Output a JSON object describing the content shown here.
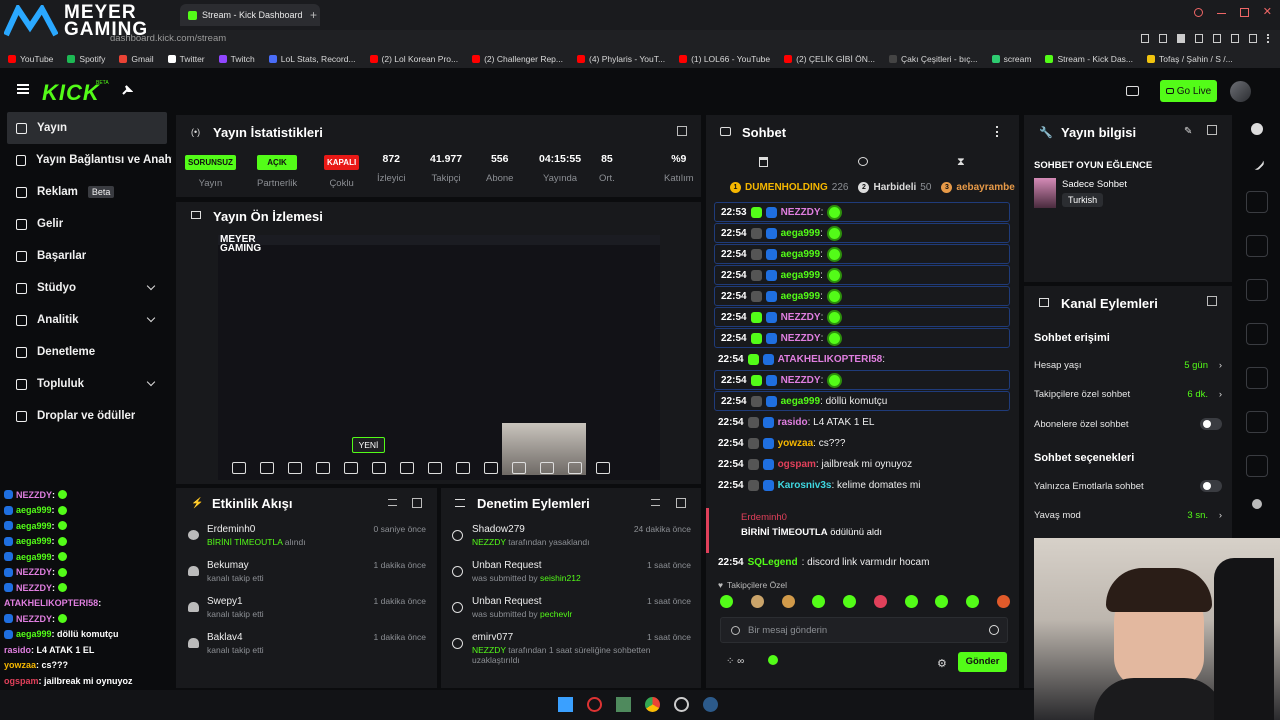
{
  "browser": {
    "tab_title": "Stream - Kick Dashboard",
    "address": "dashboard.kick.com/stream",
    "bookmarks": [
      {
        "label": "YouTube",
        "color": "#ff0000"
      },
      {
        "label": "Spotify",
        "color": "#1db954"
      },
      {
        "label": "Gmail",
        "color": "#ea4335"
      },
      {
        "label": "Twitter",
        "color": "#ffffff"
      },
      {
        "label": "Twitch",
        "color": "#9146ff"
      },
      {
        "label": "LoL Stats, Record...",
        "color": "#4a6cf7"
      },
      {
        "label": "(2) Lol Korean Pro...",
        "color": "#ff0000"
      },
      {
        "label": "(2) Challenger Rep...",
        "color": "#ff0000"
      },
      {
        "label": "(4) Phylaris - YouT...",
        "color": "#ff0000"
      },
      {
        "label": "(1) LOL66 - YouTube",
        "color": "#ff0000"
      },
      {
        "label": "(2) ÇELİK GİBİ ÖN...",
        "color": "#ff0000"
      },
      {
        "label": "Çakı Çeşitleri - bıç...",
        "color": "#444444"
      },
      {
        "label": "scream",
        "color": "#2ecc71"
      },
      {
        "label": "Stream - Kick Das...",
        "color": "#53fc18"
      },
      {
        "label": "Tofaş / Şahin / S /...",
        "color": "#f1c40f"
      }
    ]
  },
  "overlay_logo": {
    "line1": "MEYER",
    "line2": "GAMING"
  },
  "header": {
    "logo": "KICK",
    "logo_sup": "BETA",
    "go_live": "Go Live"
  },
  "sidebar": {
    "items": [
      {
        "label": "Yayın",
        "icon": "broadcast-icon"
      },
      {
        "label": "Yayın Bağlantısı ve Anahtarı",
        "icon": "link-icon"
      },
      {
        "label": "Reklam",
        "icon": "ad-icon",
        "badge": "Beta"
      },
      {
        "label": "Gelir",
        "icon": "revenue-icon"
      },
      {
        "label": "Başarılar",
        "icon": "trophy-icon"
      },
      {
        "label": "Stüdyo",
        "icon": "studio-icon"
      },
      {
        "label": "Analitik",
        "icon": "analytics-icon"
      },
      {
        "label": "Denetleme",
        "icon": "moderation-icon"
      },
      {
        "label": "Topluluk",
        "icon": "community-icon"
      },
      {
        "label": "Droplar ve ödüller",
        "icon": "drops-icon"
      }
    ]
  },
  "stats": {
    "title": "Yayın İstatistikleri",
    "items": [
      {
        "value": "SORUNSUZ",
        "label": "Yayın",
        "type": "green"
      },
      {
        "value": "AÇIK",
        "label": "Partnerlik",
        "type": "green"
      },
      {
        "value": "KAPALI",
        "label": "Çoklu",
        "type": "red"
      },
      {
        "value": "872",
        "label": "İzleyici",
        "type": "num"
      },
      {
        "value": "41.977",
        "label": "Takipçi",
        "type": "num"
      },
      {
        "value": "556",
        "label": "Abone",
        "type": "num"
      },
      {
        "value": "04:15:55",
        "label": "Yayında",
        "type": "num"
      },
      {
        "value": "85",
        "label": "Ort.",
        "type": "num"
      },
      {
        "value": "%9",
        "label": "Katılım",
        "type": "num"
      }
    ]
  },
  "preview": {
    "title": "Yayın Ön İzlemesi",
    "new_label": "YENİ"
  },
  "activity": {
    "title": "Etkinlik Akışı",
    "items": [
      {
        "name": "Erdeminh0",
        "detail_a": "BİRİNİ TİMEOUTLA",
        "detail_b": " alındı",
        "time": "0 saniye önce",
        "icon": "redeem-icon"
      },
      {
        "name": "Bekumay",
        "detail_a": "",
        "detail_b": "kanalı takip etti",
        "time": "1 dakika önce",
        "icon": "heart-icon"
      },
      {
        "name": "Swepy1",
        "detail_a": "",
        "detail_b": "kanalı takip etti",
        "time": "1 dakika önce",
        "icon": "heart-icon"
      },
      {
        "name": "Baklav4",
        "detail_a": "",
        "detail_b": "kanalı takip etti",
        "time": "1 dakika önce",
        "icon": "heart-icon"
      }
    ]
  },
  "moderation": {
    "title": "Denetim Eylemleri",
    "items": [
      {
        "title": "Shadow279",
        "by": "NEZZDY",
        "text": " tarafından yasaklandı",
        "time": "24 dakika önce",
        "icon": "ban-icon"
      },
      {
        "title": "Unban Request",
        "by": "seishin212",
        "text": "was submitted by ",
        "time": "1 saat önce",
        "icon": "history-icon"
      },
      {
        "title": "Unban Request",
        "by": "pechevlr",
        "text": "was submitted by ",
        "time": "1 saat önce",
        "icon": "history-icon"
      },
      {
        "title": "emirv077",
        "by": "NEZZDY",
        "text": " tarafından 1 saat süreliğine sohbetten uzaklaştırıldı",
        "time": "1 saat önce",
        "icon": "hourglass-icon"
      }
    ]
  },
  "chat": {
    "title": "Sohbet",
    "leaderboard": [
      {
        "rank": "1",
        "name": "DUMENHOLDING",
        "count": "226",
        "color": "#f5b700"
      },
      {
        "rank": "2",
        "name": "Harbideli",
        "count": "50",
        "color": "#dcdcdc"
      },
      {
        "rank": "3",
        "name": "aebayrambe",
        "count": "",
        "color": "#e79a48"
      }
    ],
    "messages": [
      {
        "time": "22:53",
        "user": "NEZZDY",
        "text": ":",
        "color": "#e07fe0",
        "emote": true,
        "box": true
      },
      {
        "time": "22:54",
        "user": "aega999",
        "text": ":",
        "color": "#53fc18",
        "emote": true,
        "box": true
      },
      {
        "time": "22:54",
        "user": "aega999",
        "text": ":",
        "color": "#53fc18",
        "emote": true,
        "box": true
      },
      {
        "time": "22:54",
        "user": "aega999",
        "text": ":",
        "color": "#53fc18",
        "emote": true,
        "box": true
      },
      {
        "time": "22:54",
        "user": "aega999",
        "text": ":",
        "color": "#53fc18",
        "emote": true,
        "box": true
      },
      {
        "time": "22:54",
        "user": "NEZZDY",
        "text": ":",
        "color": "#e07fe0",
        "emote": true,
        "box": true
      },
      {
        "time": "22:54",
        "user": "NEZZDY",
        "text": ":",
        "color": "#e07fe0",
        "emote": true,
        "box": true
      },
      {
        "time": "22:54",
        "user": "ATAKHELIKOPTERI58",
        "text": ":",
        "color": "#e07fe0",
        "emote": false,
        "box": false
      },
      {
        "time": "22:54",
        "user": "NEZZDY",
        "text": ":",
        "color": "#e07fe0",
        "emote": true,
        "box": true
      },
      {
        "time": "22:54",
        "user": "aega999",
        "text": ": döllü komutçu",
        "color": "#53fc18",
        "emote": false,
        "box": true
      },
      {
        "time": "22:54",
        "user": "rasido",
        "text": ": L4 ATAK 1 EL",
        "color": "#e07fe0",
        "emote": false,
        "box": false
      },
      {
        "time": "22:54",
        "user": "yowzaa",
        "text": ": cs???",
        "color": "#f5b700",
        "emote": false,
        "box": false
      },
      {
        "time": "22:54",
        "user": "ogspam",
        "text": ": jailbreak mi oynuyoz",
        "color": "#e0405a",
        "emote": false,
        "box": false
      },
      {
        "time": "22:54",
        "user": "Karosniv3s",
        "text": ": kelime domates mi",
        "color": "#3fd7e0",
        "emote": false,
        "box": false
      }
    ],
    "redeem": {
      "user": "Erdeminh0",
      "reward": "BİRİNİ TİMEOUTLA",
      "suffix": " ödülünü aldı"
    },
    "last": {
      "time": "22:54",
      "user": "SQLegend",
      "text": ": discord link varmıdır hocam",
      "color": "#53fc18"
    },
    "followers_only": "Takipçilere Özel",
    "input_placeholder": "Bir mesaj gönderin",
    "send": "Gönder"
  },
  "stream_info": {
    "title": "Yayın bilgisi",
    "stream_title": "SOHBET OYUN EĞLENCE",
    "category": "Sadece Sohbet",
    "language": "Turkish"
  },
  "channel_actions": {
    "title": "Kanal Eylemleri",
    "access_heading": "Sohbet erişimi",
    "account_age_label": "Hesap yaşı",
    "account_age_value": "5 gün",
    "followers_label": "Takipçilere özel sohbet",
    "followers_value": "6 dk.",
    "subs_label": "Abonelere özel sohbet",
    "options_heading": "Sohbet seçenekleri",
    "emote_only_label": "Yalnızca Emotlarla sohbet",
    "slow_label": "Yavaş mod",
    "slow_value": "3 sn."
  },
  "overlay_chat": [
    {
      "user": "NEZZDY",
      "text": ":",
      "color": "#e07fe0",
      "emote": true
    },
    {
      "user": "aega999",
      "text": ":",
      "color": "#53fc18",
      "emote": true
    },
    {
      "user": "aega999",
      "text": ":",
      "color": "#53fc18",
      "emote": true
    },
    {
      "user": "aega999",
      "text": ":",
      "color": "#53fc18",
      "emote": true
    },
    {
      "user": "aega999",
      "text": ":",
      "color": "#53fc18",
      "emote": true
    },
    {
      "user": "NEZZDY",
      "text": ":",
      "color": "#e07fe0",
      "emote": true
    },
    {
      "user": "NEZZDY",
      "text": ":",
      "color": "#e07fe0",
      "emote": true
    },
    {
      "user": "ATAKHELIKOPTERI58",
      "text": ":",
      "color": "#e07fe0",
      "emote": false
    },
    {
      "user": "NEZZDY",
      "text": ":",
      "color": "#e07fe0",
      "emote": true
    },
    {
      "user": "aega999",
      "text": ": döllü komutçu",
      "color": "#53fc18",
      "emote": false
    },
    {
      "user": "rasido",
      "text": ": L4 ATAK 1 EL",
      "color": "#e07fe0",
      "emote": false
    },
    {
      "user": "yowzaa",
      "text": ": cs???",
      "color": "#f5b700",
      "emote": false
    },
    {
      "user": "ogspam",
      "text": ": jailbreak mi oynuyoz",
      "color": "#e0405a",
      "emote": false
    },
    {
      "user": "Karosniv3s",
      "text": ": kelime domates mi",
      "color": "#3fd7e0",
      "emote": false
    },
    {
      "user": "SQLegend",
      "text": ": discord link varmıdır hocam",
      "color": "#53fc18",
      "emote": false
    }
  ],
  "colors": {
    "kick_green": "#53fc18",
    "danger": "#e91916",
    "bg": "#0b0c0e",
    "panel": "#18191c"
  }
}
